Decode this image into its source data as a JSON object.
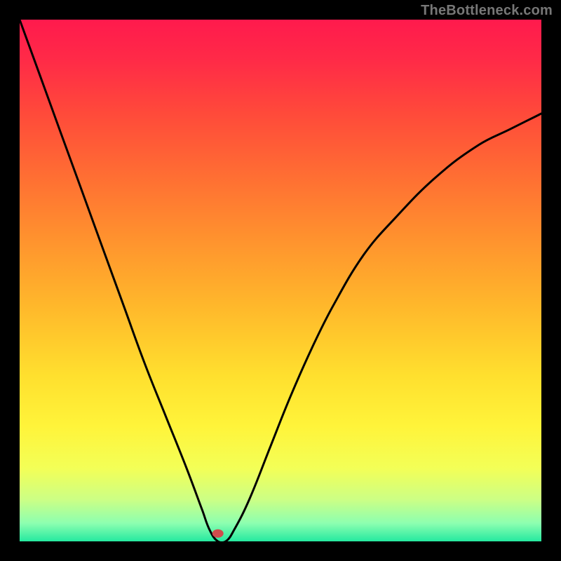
{
  "watermark": "TheBottleneck.com",
  "marker": {
    "x_frac": 0.38,
    "y_frac": 0.985,
    "color": "#cf4d4d",
    "rx": 8,
    "ry": 6
  },
  "gradient_stops": [
    {
      "offset": 0.0,
      "color": "#ff1a4d"
    },
    {
      "offset": 0.08,
      "color": "#ff2b47"
    },
    {
      "offset": 0.18,
      "color": "#ff4a3a"
    },
    {
      "offset": 0.3,
      "color": "#ff6e33"
    },
    {
      "offset": 0.42,
      "color": "#ff922e"
    },
    {
      "offset": 0.55,
      "color": "#ffb82b"
    },
    {
      "offset": 0.68,
      "color": "#ffdf2e"
    },
    {
      "offset": 0.78,
      "color": "#fff43a"
    },
    {
      "offset": 0.86,
      "color": "#f3ff57"
    },
    {
      "offset": 0.92,
      "color": "#ccff85"
    },
    {
      "offset": 0.965,
      "color": "#8dffb0"
    },
    {
      "offset": 1.0,
      "color": "#25e9a0"
    }
  ],
  "chart_data": {
    "type": "line",
    "title": "",
    "xlabel": "",
    "ylabel": "",
    "xlim": [
      0,
      1
    ],
    "ylim": [
      0,
      1
    ],
    "series": [
      {
        "name": "bottleneck-curve",
        "x": [
          0.0,
          0.04,
          0.08,
          0.12,
          0.16,
          0.2,
          0.24,
          0.28,
          0.32,
          0.35,
          0.365,
          0.38,
          0.395,
          0.41,
          0.44,
          0.48,
          0.52,
          0.56,
          0.6,
          0.66,
          0.72,
          0.8,
          0.88,
          0.94,
          1.0
        ],
        "y": [
          1.0,
          0.89,
          0.78,
          0.67,
          0.56,
          0.45,
          0.34,
          0.24,
          0.14,
          0.06,
          0.02,
          0.0,
          0.0,
          0.02,
          0.08,
          0.18,
          0.28,
          0.37,
          0.45,
          0.55,
          0.62,
          0.7,
          0.76,
          0.79,
          0.82
        ]
      }
    ],
    "note": "x and y are normalized fractions of plot width/height; y=0 is bottom (green), y=1 is top (red). Curve minimum at x≈0.38."
  }
}
